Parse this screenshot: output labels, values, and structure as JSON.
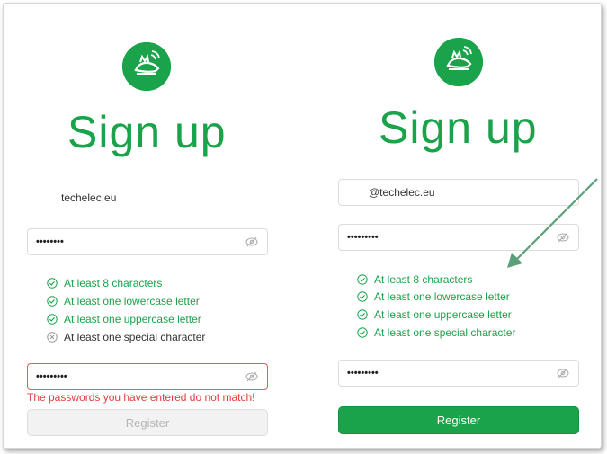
{
  "left": {
    "title": "Sign up",
    "email": "techelec.eu",
    "password": "••••••••",
    "confirm": "•••••••••",
    "rules": [
      {
        "label": "At least 8 characters",
        "ok": true
      },
      {
        "label": "At least one lowercase letter",
        "ok": true
      },
      {
        "label": "At least one uppercase letter",
        "ok": true
      },
      {
        "label": "At least one special character",
        "ok": false
      }
    ],
    "error": "The passwords you have entered do not match!",
    "register_label": "Register"
  },
  "right": {
    "title": "Sign up",
    "email": "@techelec.eu",
    "password": "•••••••••",
    "confirm": "•••••••••",
    "rules": [
      {
        "label": "At least 8 characters",
        "ok": true
      },
      {
        "label": "At least one lowercase letter",
        "ok": true
      },
      {
        "label": "At least one uppercase letter",
        "ok": true
      },
      {
        "label": "At least one special character",
        "ok": true
      }
    ],
    "register_label": "Register"
  },
  "colors": {
    "brand": "#1aa34a",
    "error": "#e03b3b",
    "arrow": "#5aa07a"
  },
  "icons": {
    "logo": "fox-logo-icon",
    "eye": "eye-slash-icon",
    "check": "check-circle-icon",
    "cross": "x-circle-icon"
  }
}
